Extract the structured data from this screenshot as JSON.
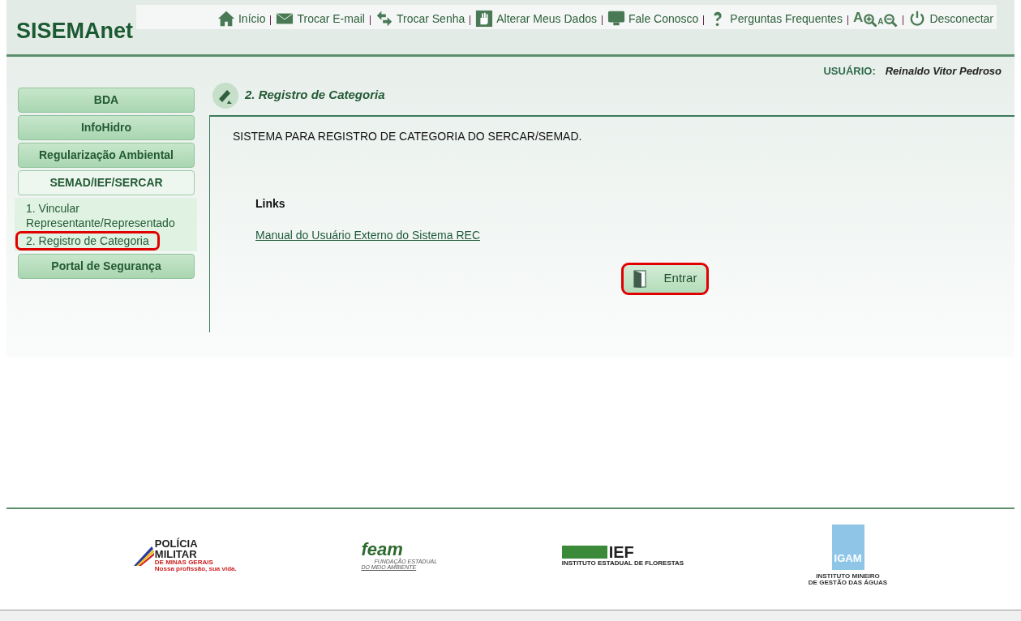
{
  "logo": "SISEMAnet",
  "toolbar": [
    {
      "kind": "home",
      "label": "Início"
    },
    {
      "kind": "mail",
      "label": "Trocar E-mail"
    },
    {
      "kind": "swap",
      "label": "Trocar Senha"
    },
    {
      "kind": "hand",
      "label": "Alterar Meus Dados"
    },
    {
      "kind": "chat",
      "label": "Fale Conosco"
    },
    {
      "kind": "help",
      "label": "Perguntas Frequentes"
    },
    {
      "kind": "zoomin",
      "label": "A"
    },
    {
      "kind": "zoomout",
      "label": "A"
    },
    {
      "kind": "power",
      "label": "Desconectar"
    }
  ],
  "user": {
    "label": "USUÁRIO:",
    "name": "Reinaldo Vitor Pedroso"
  },
  "sidebar": {
    "items": [
      {
        "label": "BDA",
        "expanded": false
      },
      {
        "label": "InfoHidro",
        "expanded": false
      },
      {
        "label": "Regularização Ambiental",
        "expanded": false
      },
      {
        "label": "SEMAD/IEF/SERCAR",
        "expanded": true,
        "children": [
          {
            "label": "1. Vincular Representante/Representado",
            "highlighted": false
          },
          {
            "label": "2. Registro de Categoria",
            "highlighted": true
          }
        ]
      },
      {
        "label": "Portal de Segurança",
        "expanded": false
      }
    ]
  },
  "page_title": "2. Registro de Categoria",
  "content": {
    "description": "SISTEMA PARA REGISTRO DE CATEGORIA DO SERCAR/SEMAD.",
    "links_heading": "Links",
    "links": [
      "Manual do Usuário Externo do Sistema REC"
    ],
    "button": {
      "label": "Entrar",
      "highlighted": true
    }
  },
  "footer_logos": [
    {
      "kind": "pm",
      "lines": [
        "POLÍCIA",
        "MILITAR",
        "DE MINAS GERAIS",
        "Nossa profissão, sua vida."
      ]
    },
    {
      "kind": "feam",
      "lines": [
        "feam",
        "FUNDAÇÃO ESTADUAL",
        "DO MEIO AMBIENTE"
      ]
    },
    {
      "kind": "ief",
      "lines": [
        "IEF",
        "INSTITUTO ESTADUAL DE FLORESTAS"
      ]
    },
    {
      "kind": "igam",
      "lines": [
        "IGAM",
        "INSTITUTO MINEIRO",
        "DE GESTÃO DAS ÁGUAS"
      ]
    }
  ]
}
